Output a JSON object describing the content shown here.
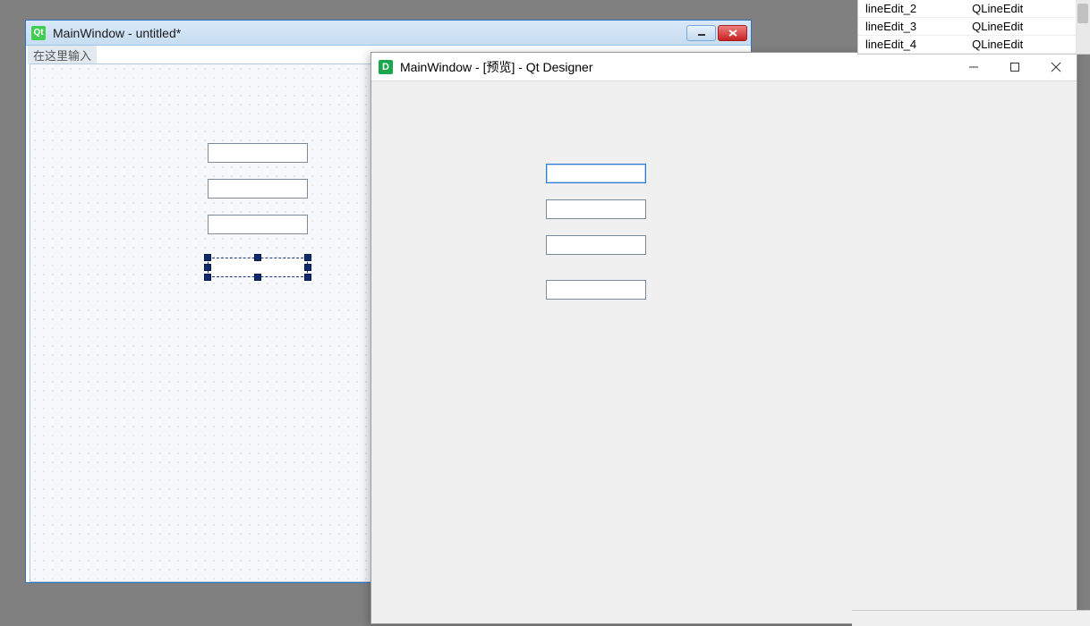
{
  "designer_window": {
    "title": "MainWindow - untitled*",
    "menu_placeholder": "在这里输入",
    "line_edits": [
      "",
      "",
      ""
    ],
    "selected_line_edit_value": ""
  },
  "preview_window": {
    "title": "MainWindow - [预览] - Qt Designer",
    "line_edits": [
      "",
      "",
      "",
      ""
    ]
  },
  "object_inspector": {
    "rows": [
      {
        "name": "lineEdit_2",
        "class": "QLineEdit"
      },
      {
        "name": "lineEdit_3",
        "class": "QLineEdit"
      },
      {
        "name": "lineEdit_4",
        "class": "QLineEdit"
      }
    ]
  },
  "icons": {
    "qt_abbrev": "Qt",
    "d_abbrev": "D"
  }
}
